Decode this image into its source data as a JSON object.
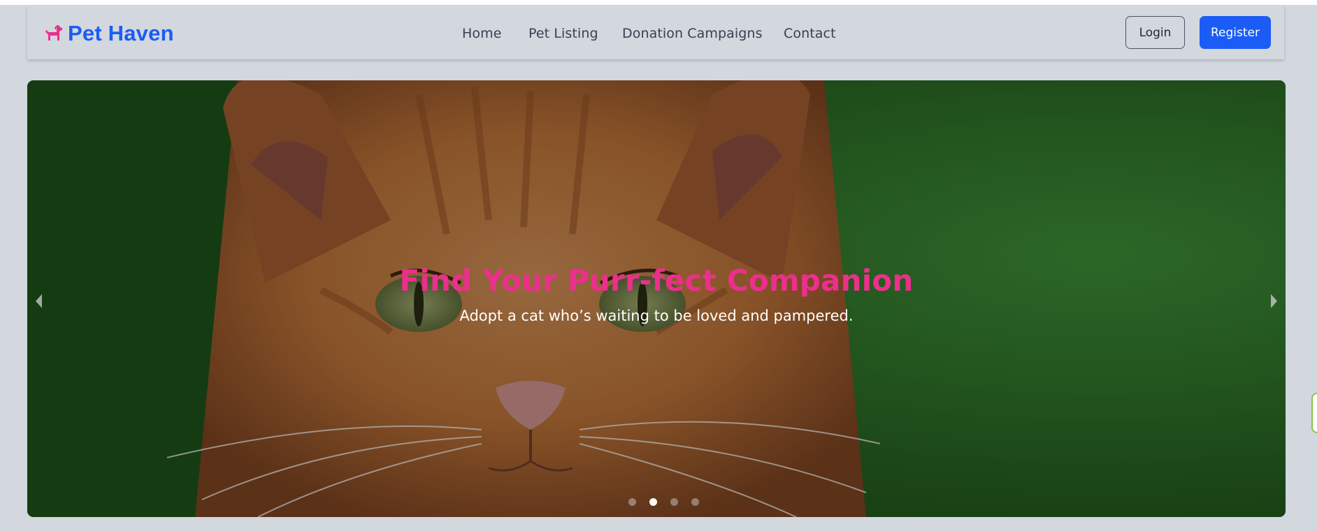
{
  "brand": {
    "name": "Pet Haven",
    "icon": "dog-icon",
    "name_color": "#1a5cf5",
    "icon_color": "#ec2f8c"
  },
  "nav": {
    "links": [
      {
        "label": "Home"
      },
      {
        "label": "Pet Listing"
      },
      {
        "label": "Donation Campaigns"
      },
      {
        "label": "Contact"
      }
    ]
  },
  "auth": {
    "login_label": "Login",
    "register_label": "Register",
    "register_color": "#1a5cf5"
  },
  "hero": {
    "title": "Find Your Purr-fect Companion",
    "subtitle": "Adopt a cat who’s waiting to be loved and pampered.",
    "title_color": "#ec2f8c",
    "slide_count": 4,
    "active_slide": 2,
    "prev_icon": "chevron-left-icon",
    "next_icon": "chevron-right-icon"
  }
}
